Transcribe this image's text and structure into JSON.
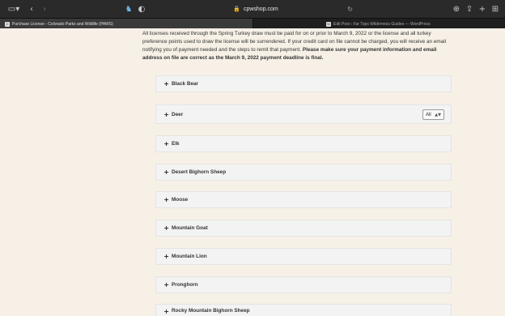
{
  "browser": {
    "address": "cpwshop.com",
    "tabs": [
      {
        "label": "Purchase License - Colorado Parks and Wildlife (PAWS)",
        "favicon": "C"
      },
      {
        "label": "Edit Post ‹ Far Tops Wilderness Guides — WordPress",
        "favicon": "W"
      }
    ]
  },
  "notice": {
    "text": "All licenses received through the Spring Turkey draw must be paid for on or prior to March 9, 2022 or the license and all turkey preference points used to draw the license will be surrendered. If your credit card on file cannot be charged, you will receive an email notifying you of payment needed and the steps to remit that payment. ",
    "bold_text": "Please make sure your payment information and email address on file are correct as the March 9, 2022 payment deadline is final."
  },
  "species": [
    {
      "label": "Black Bear"
    },
    {
      "label": "Deer",
      "filter": "All"
    },
    {
      "label": "Elk"
    },
    {
      "label": "Desert Bighorn Sheep"
    },
    {
      "label": "Moose"
    },
    {
      "label": "Mountain Goat"
    },
    {
      "label": "Mountain Lion"
    },
    {
      "label": "Pronghorn"
    },
    {
      "label": "Rocky Mountain Bighorn Sheep"
    }
  ],
  "icons": {
    "sidebar": "sidebar-icon",
    "back": "chevron-left-icon",
    "forward": "chevron-right-icon",
    "extension": "extension-icon",
    "privacy": "shield-icon",
    "lock": "lock-icon",
    "reload": "reload-icon",
    "download": "download-icon",
    "share": "share-icon",
    "new_tab": "plus-icon",
    "tab_overview": "grid-icon",
    "expand": "plus-icon"
  },
  "colors": {
    "page_bg": "#f6f0e6",
    "panel_bg": "#f3f3f3",
    "chrome_bg": "#2a2a2a"
  }
}
